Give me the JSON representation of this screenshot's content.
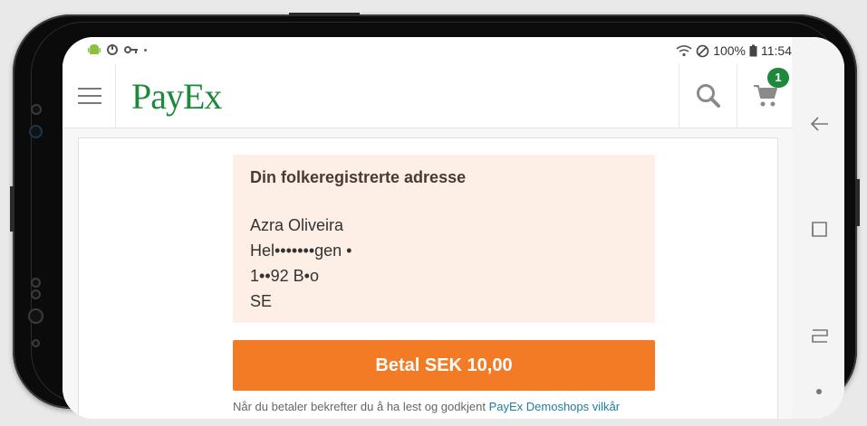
{
  "status_bar": {
    "left_icons": [
      "android-icon",
      "sync-icon",
      "key-icon",
      "dot-icon"
    ],
    "battery": "100%",
    "time": "11:54"
  },
  "header": {
    "logo": "PayEx",
    "cart_count": "1"
  },
  "address": {
    "title": "Din folkeregistrerte adresse",
    "name": "Azra Oliveira",
    "street": "Hel•••••••gen •",
    "postal": "1••92 B•o",
    "country": "SE"
  },
  "payment": {
    "button_label": "Betal SEK 10,00",
    "terms_text": "Når du betaler bekrefter du å ha lest og godkjent ",
    "terms_link": "PayEx Demoshops vilkår"
  },
  "nav": {
    "icons": [
      "back-icon",
      "recents-icon",
      "home-icon",
      "dot-icon"
    ]
  },
  "colors": {
    "brand_green": "#1c8a3a",
    "pay_orange": "#f47b25",
    "address_bg": "#fdefe5",
    "link": "#1f7ca0"
  }
}
